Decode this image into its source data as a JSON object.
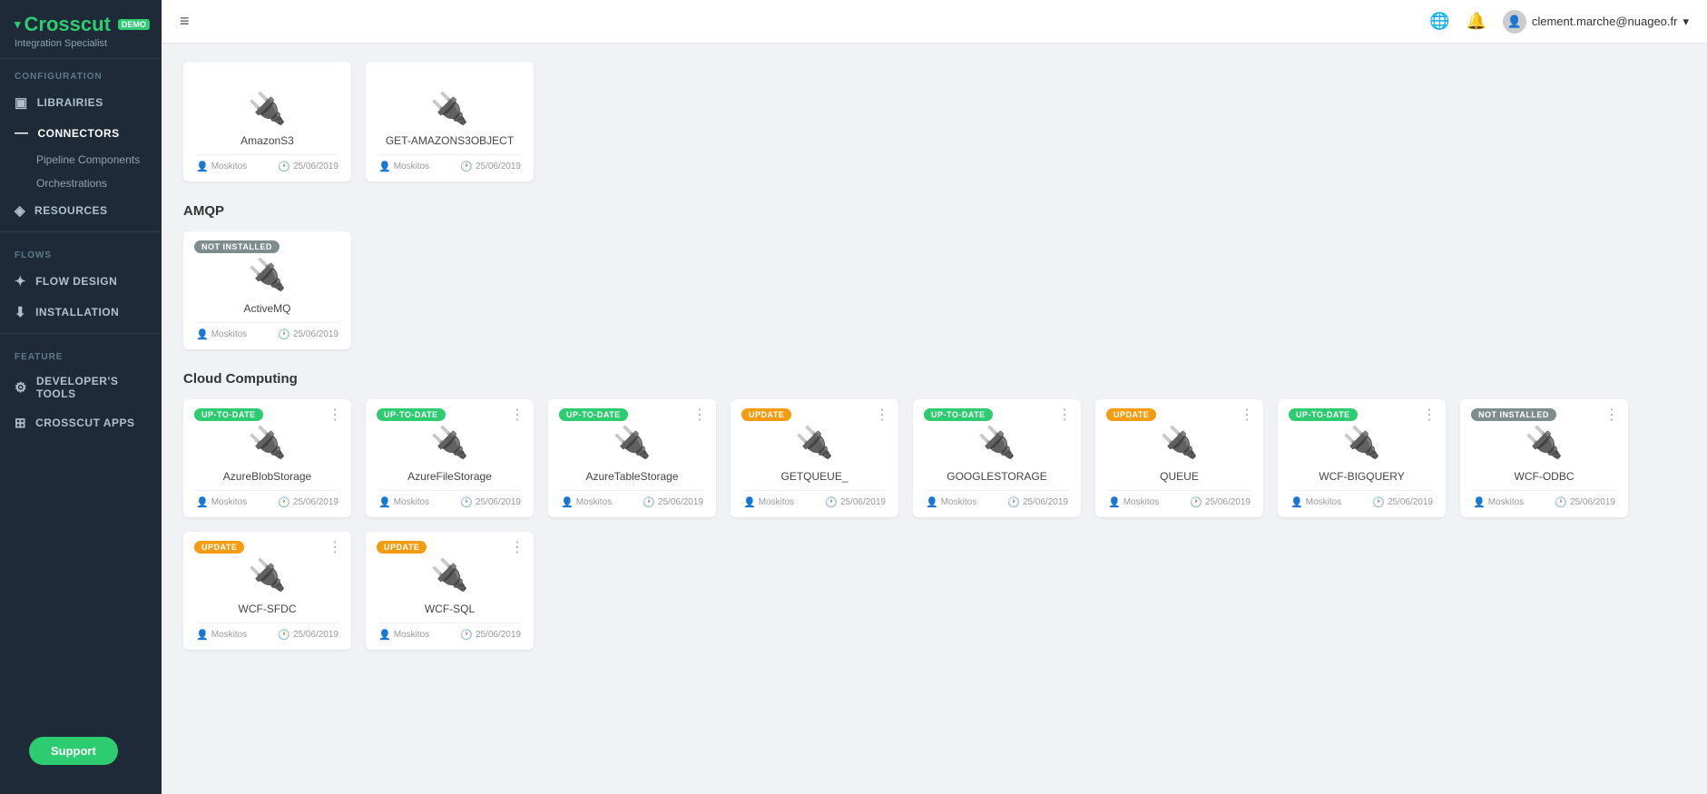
{
  "sidebar": {
    "demo_badge": "DEMO",
    "app_name": "Crosscut",
    "subtitle": "Integration Specialist",
    "sections": [
      {
        "label": "CONFIGURATION",
        "items": [
          {
            "id": "libraries",
            "label": "LIBRAIRIES",
            "icon": "☰",
            "type": "item"
          },
          {
            "id": "connectors",
            "label": "Connectors",
            "icon": "—",
            "type": "sub-parent"
          },
          {
            "id": "pipeline",
            "label": "Pipeline Components",
            "type": "sub"
          },
          {
            "id": "orchestrations",
            "label": "Orchestrations",
            "type": "sub"
          },
          {
            "id": "resources",
            "label": "RESOURCES",
            "icon": "◈",
            "type": "item"
          }
        ]
      },
      {
        "label": "FLOWS",
        "items": [
          {
            "id": "flow-design",
            "label": "FLOW DESIGN",
            "icon": "❋",
            "type": "item"
          },
          {
            "id": "installation",
            "label": "INSTALLATION",
            "icon": "⬇",
            "type": "item"
          }
        ]
      },
      {
        "label": "FEATURE",
        "items": [
          {
            "id": "dev-tools",
            "label": "DEVELOPER'S TOOLS",
            "icon": "⚙",
            "type": "item"
          },
          {
            "id": "crosscut-apps",
            "label": "CROSSCUT APPS",
            "icon": "⊞",
            "type": "item"
          }
        ]
      }
    ],
    "support_label": "Support"
  },
  "topbar": {
    "menu_icon": "≡",
    "globe_icon": "🌐",
    "bell_icon": "🔔",
    "user_icon": "👤",
    "user_email": "clement.marche@nuageo.fr",
    "chevron": "▾"
  },
  "content": {
    "amazon_section": {
      "title": "",
      "cards": [
        {
          "id": "amazons3",
          "name": "AmazonS3",
          "badge": null,
          "author": "Moskitos",
          "date": "25/06/2019"
        },
        {
          "id": "get-amazons3object",
          "name": "GET-AMAZONS3OBJECT",
          "badge": null,
          "author": "Moskitos",
          "date": "25/06/2019"
        }
      ]
    },
    "amqp_section": {
      "title": "AMQP",
      "cards": [
        {
          "id": "activemq",
          "name": "ActiveMQ",
          "badge": "NOT INSTALLED",
          "badge_type": "notinstalled",
          "author": "Moskitos",
          "date": "25/06/2019"
        }
      ]
    },
    "cloud_section": {
      "title": "Cloud Computing",
      "cards": [
        {
          "id": "azureblobstorage",
          "name": "AzureBlobStorage",
          "badge": "UP-TO-DATE",
          "badge_type": "uptodate",
          "author": "Moskitos",
          "date": "25/06/2019"
        },
        {
          "id": "azurefilestorage",
          "name": "AzureFileStorage",
          "badge": "UP-TO-DATE",
          "badge_type": "uptodate",
          "author": "Moskitos",
          "date": "25/06/2019"
        },
        {
          "id": "azuretablestorage",
          "name": "AzureTableStorage",
          "badge": "UP-TO-DATE",
          "badge_type": "uptodate",
          "author": "Moskitos",
          "date": "25/06/2019"
        },
        {
          "id": "getqueue",
          "name": "GETQUEUE_",
          "badge": "UPDATE",
          "badge_type": "update",
          "author": "Moskitos",
          "date": "25/06/2019"
        },
        {
          "id": "googlestorage",
          "name": "GOOGLESTORAGE",
          "badge": "UP-TO-DATE",
          "badge_type": "uptodate",
          "author": "Moskitos",
          "date": "25/06/2019"
        },
        {
          "id": "queue",
          "name": "QUEUE",
          "badge": "UPDATE",
          "badge_type": "update",
          "author": "Moskitos",
          "date": "25/06/2019"
        },
        {
          "id": "wcf-bigquery",
          "name": "WCF-BIGQUERY",
          "badge": "UP-TO-DATE",
          "badge_type": "uptodate",
          "author": "Moskitos",
          "date": "25/06/2019"
        },
        {
          "id": "wcf-odbc",
          "name": "WCF-ODBC",
          "badge": "NOT INSTALLED",
          "badge_type": "notinstalled",
          "author": "Moskitos",
          "date": "25/06/2019"
        },
        {
          "id": "wcf-sfdc",
          "name": "WCF-SFDC",
          "badge": "UPDATE",
          "badge_type": "update",
          "author": "Moskitos",
          "date": "25/06/2019"
        },
        {
          "id": "wcf-sql",
          "name": "WCF-SQL",
          "badge": "UPDATE",
          "badge_type": "update",
          "author": "Moskitos",
          "date": "25/06/2019"
        }
      ]
    }
  },
  "icons": {
    "plug": "🔌",
    "user": "👤",
    "clock": "🕐",
    "more": "⋮"
  }
}
